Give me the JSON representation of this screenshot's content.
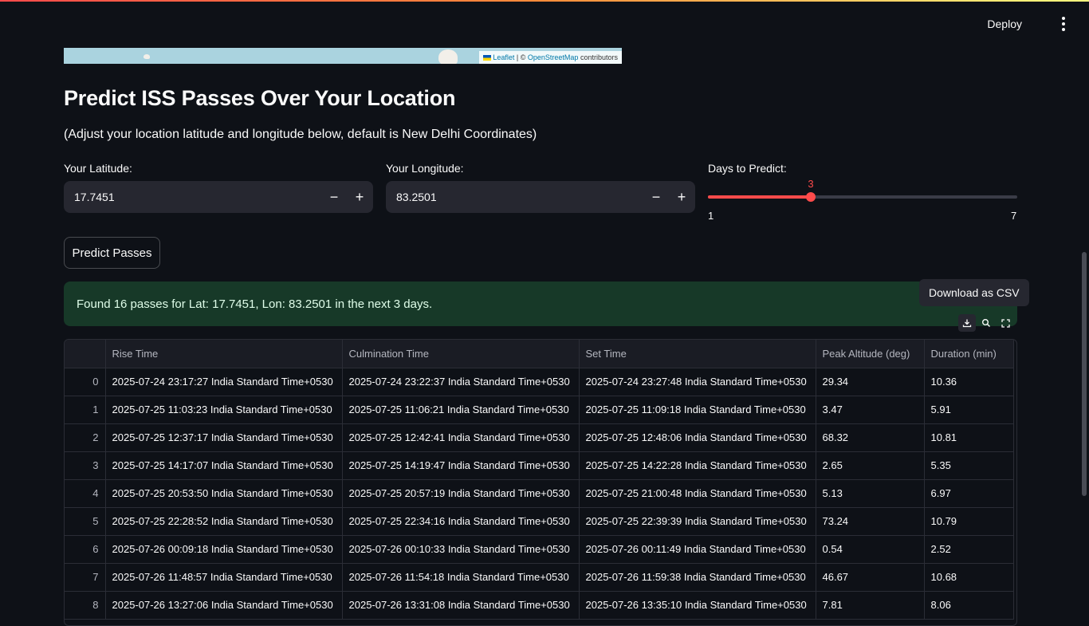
{
  "header": {
    "deploy_label": "Deploy",
    "menu_icon": "kebab-menu-icon"
  },
  "map": {
    "attribution_leaflet": "Leaflet",
    "attribution_sep": "| ©",
    "attribution_osm": "OpenStreetMap",
    "attribution_tail": "contributors"
  },
  "page": {
    "title": "Predict ISS Passes Over Your Location",
    "subtitle": "(Adjust your location latitude and longitude below, default is New Delhi Coordinates)"
  },
  "inputs": {
    "latitude": {
      "label": "Your Latitude:",
      "value": "17.7451",
      "minus": "−",
      "plus": "+"
    },
    "longitude": {
      "label": "Your Longitude:",
      "value": "83.2501",
      "minus": "−",
      "plus": "+"
    },
    "days": {
      "label": "Days to Predict:",
      "value": "3",
      "min": "1",
      "max": "7",
      "fraction": 0.3333
    }
  },
  "actions": {
    "predict_label": "Predict Passes"
  },
  "result": {
    "message": "Found 16 passes for Lat: 17.7451, Lon: 83.2501 in the next 3 days."
  },
  "table_toolbar": {
    "tooltip": "Download as CSV",
    "icons": [
      "download-icon",
      "search-icon",
      "fullscreen-icon"
    ]
  },
  "colors": {
    "accent": "#ff4b4b",
    "success_bg": "#173928",
    "background": "#0e1117"
  },
  "table": {
    "columns": [
      "",
      "Rise Time",
      "Culmination Time",
      "Set Time",
      "Peak Altitude (deg)",
      "Duration (min)"
    ],
    "rows": [
      [
        "0",
        "2025-07-24 23:17:27 India Standard Time+0530",
        "2025-07-24 23:22:37 India Standard Time+0530",
        "2025-07-24 23:27:48 India Standard Time+0530",
        "29.34",
        "10.36"
      ],
      [
        "1",
        "2025-07-25 11:03:23 India Standard Time+0530",
        "2025-07-25 11:06:21 India Standard Time+0530",
        "2025-07-25 11:09:18 India Standard Time+0530",
        "3.47",
        "5.91"
      ],
      [
        "2",
        "2025-07-25 12:37:17 India Standard Time+0530",
        "2025-07-25 12:42:41 India Standard Time+0530",
        "2025-07-25 12:48:06 India Standard Time+0530",
        "68.32",
        "10.81"
      ],
      [
        "3",
        "2025-07-25 14:17:07 India Standard Time+0530",
        "2025-07-25 14:19:47 India Standard Time+0530",
        "2025-07-25 14:22:28 India Standard Time+0530",
        "2.65",
        "5.35"
      ],
      [
        "4",
        "2025-07-25 20:53:50 India Standard Time+0530",
        "2025-07-25 20:57:19 India Standard Time+0530",
        "2025-07-25 21:00:48 India Standard Time+0530",
        "5.13",
        "6.97"
      ],
      [
        "5",
        "2025-07-25 22:28:52 India Standard Time+0530",
        "2025-07-25 22:34:16 India Standard Time+0530",
        "2025-07-25 22:39:39 India Standard Time+0530",
        "73.24",
        "10.79"
      ],
      [
        "6",
        "2025-07-26 00:09:18 India Standard Time+0530",
        "2025-07-26 00:10:33 India Standard Time+0530",
        "2025-07-26 00:11:49 India Standard Time+0530",
        "0.54",
        "2.52"
      ],
      [
        "7",
        "2025-07-26 11:48:57 India Standard Time+0530",
        "2025-07-26 11:54:18 India Standard Time+0530",
        "2025-07-26 11:59:38 India Standard Time+0530",
        "46.67",
        "10.68"
      ],
      [
        "8",
        "2025-07-26 13:27:06 India Standard Time+0530",
        "2025-07-26 13:31:08 India Standard Time+0530",
        "2025-07-26 13:35:10 India Standard Time+0530",
        "7.81",
        "8.06"
      ]
    ]
  }
}
